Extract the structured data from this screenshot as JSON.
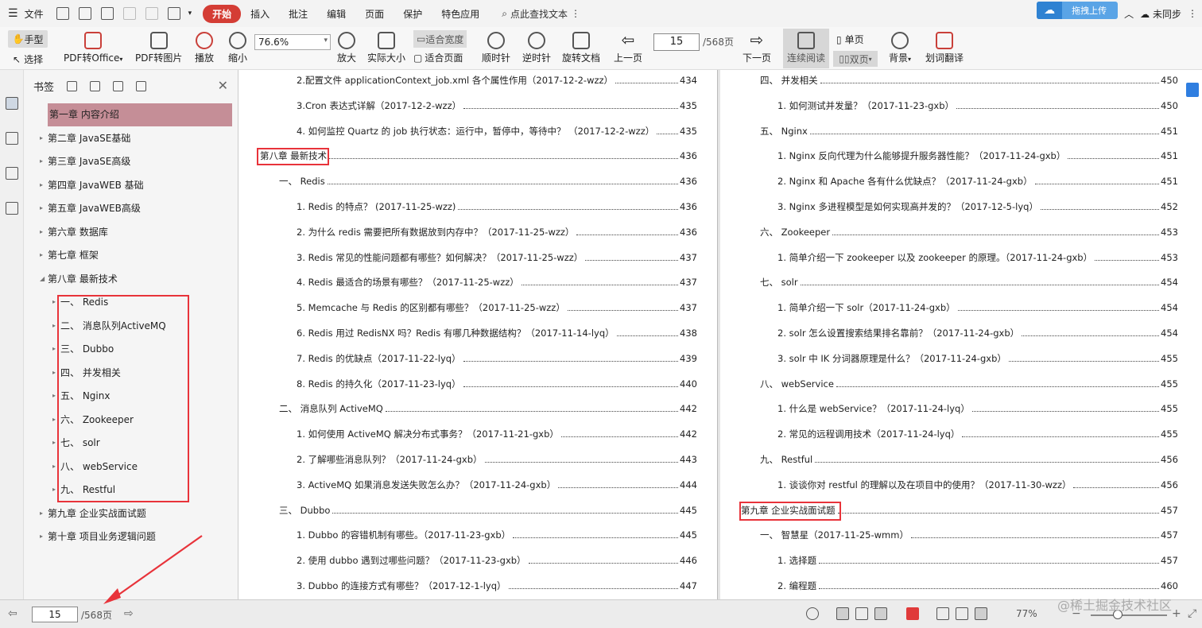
{
  "menu": {
    "file": "文件",
    "tabs": [
      "开始",
      "插入",
      "批注",
      "编辑",
      "页面",
      "保护",
      "特色应用"
    ],
    "search": "点此查找文本",
    "upload": "拖拽上传",
    "user": "未同步"
  },
  "toolbar": {
    "hand": "手型",
    "select": "选择",
    "pdf2office": "PDF转Office",
    "pdf2img": "PDF转图片",
    "play": "播放",
    "zoom_out": "缩小",
    "zoom_value": "76.6%",
    "zoom_in": "放大",
    "actual": "实际大小",
    "fit_width": "适合宽度",
    "fit_page": "适合页面",
    "cw": "顺时针",
    "ccw": "逆时针",
    "rotate": "旋转文档",
    "prev": "上一页",
    "page": "15",
    "total": "/568页",
    "next": "下一页",
    "continuous": "连续阅读",
    "single": "单页",
    "dual": "双页",
    "bg": "背景",
    "translate": "划词翻译"
  },
  "bookmarks": {
    "title": "书签",
    "items": [
      "第一章 内容介绍",
      "第二章 JavaSE基础",
      "第三章 JavaSE高级",
      "第四章 JavaWEB 基础",
      "第五章 JavaWEB高级",
      "第六章 数据库",
      "第七章 框架",
      "第八章 最新技术"
    ],
    "sub": [
      "一、 Redis",
      "二、 消息队列ActiveMQ",
      "三、 Dubbo",
      "四、 并发相关",
      "五、 Nginx",
      "六、 Zookeeper",
      "七、 solr",
      "八、 webService",
      "九、 Restful"
    ],
    "after": [
      "第九章 企业实战面试题",
      "第十章 项目业务逻辑问题"
    ]
  },
  "left_toc": [
    {
      "t": "2.配置文件 applicationContext_job.xml 各个属性作用（2017-12-2-wzz）",
      "p": "434",
      "lv": 2
    },
    {
      "t": "3.Cron 表达式详解（2017-12-2-wzz）",
      "p": "435",
      "lv": 2
    },
    {
      "t": "4. 如何监控 Quartz 的 job 执行状态：运行中，暂停中，等待中？ （2017-12-2-wzz）",
      "p": "435",
      "lv": 2
    },
    {
      "t": "第八章  最新技术",
      "p": "436",
      "lv": 0
    },
    {
      "t": "一、  Redis",
      "p": "436",
      "lv": 1
    },
    {
      "t": "1. Redis 的特点？ (2017-11-25-wzz)",
      "p": "436",
      "lv": 2
    },
    {
      "t": "2. 为什么 redis 需要把所有数据放到内存中？（2017-11-25-wzz）",
      "p": "436",
      "lv": 2
    },
    {
      "t": "3. Redis 常见的性能问题都有哪些？如何解决？（2017-11-25-wzz）",
      "p": "437",
      "lv": 2
    },
    {
      "t": "4. Redis 最适合的场景有哪些？（2017-11-25-wzz）",
      "p": "437",
      "lv": 2
    },
    {
      "t": "5. Memcache 与 Redis 的区别都有哪些？（2017-11-25-wzz）",
      "p": "437",
      "lv": 2
    },
    {
      "t": "6. Redis 用过 RedisNX 吗？Redis 有哪几种数据结构？（2017-11-14-lyq）",
      "p": "438",
      "lv": 2
    },
    {
      "t": "7. Redis 的优缺点（2017-11-22-lyq）",
      "p": "439",
      "lv": 2
    },
    {
      "t": "8. Redis 的持久化（2017-11-23-lyq）",
      "p": "440",
      "lv": 2
    },
    {
      "t": "二、  消息队列 ActiveMQ",
      "p": "442",
      "lv": 1
    },
    {
      "t": "1. 如何使用 ActiveMQ 解决分布式事务？（2017-11-21-gxb）",
      "p": "442",
      "lv": 2
    },
    {
      "t": "2. 了解哪些消息队列？（2017-11-24-gxb）",
      "p": "443",
      "lv": 2
    },
    {
      "t": "3. ActiveMQ 如果消息发送失败怎么办？（2017-11-24-gxb）",
      "p": "444",
      "lv": 2
    },
    {
      "t": "三、  Dubbo",
      "p": "445",
      "lv": 1
    },
    {
      "t": "1. Dubbo 的容错机制有哪些。（2017-11-23-gxb）",
      "p": "445",
      "lv": 2
    },
    {
      "t": "2. 使用 dubbo 遇到过哪些问题？（2017-11-23-gxb）",
      "p": "446",
      "lv": 2
    },
    {
      "t": "3. Dubbo 的连接方式有哪些？（2017-12-1-lyq）",
      "p": "447",
      "lv": 2
    }
  ],
  "right_toc": [
    {
      "t": "四、  并发相关",
      "p": "450",
      "lv": 1
    },
    {
      "t": "1. 如何测试并发量？（2017-11-23-gxb）",
      "p": "450",
      "lv": 2
    },
    {
      "t": "五、  Nginx",
      "p": "451",
      "lv": 1
    },
    {
      "t": "1. Nginx 反向代理为什么能够提升服务器性能？（2017-11-24-gxb）",
      "p": "451",
      "lv": 2
    },
    {
      "t": "2. Nginx 和 Apache 各有什么优缺点？（2017-11-24-gxb）",
      "p": "451",
      "lv": 2
    },
    {
      "t": "3. Nginx 多进程模型是如何实现高并发的？（2017-12-5-lyq）",
      "p": "452",
      "lv": 2
    },
    {
      "t": "六、  Zookeeper",
      "p": "453",
      "lv": 1
    },
    {
      "t": "1. 简单介绍一下 zookeeper 以及 zookeeper 的原理。（2017-11-24-gxb）",
      "p": "453",
      "lv": 2
    },
    {
      "t": "七、  solr",
      "p": "454",
      "lv": 1
    },
    {
      "t": "1. 简单介绍一下 solr（2017-11-24-gxb）",
      "p": "454",
      "lv": 2
    },
    {
      "t": "2. solr 怎么设置搜索结果排名靠前？（2017-11-24-gxb）",
      "p": "454",
      "lv": 2
    },
    {
      "t": "3. solr 中 IK 分词器原理是什么？（2017-11-24-gxb）",
      "p": "455",
      "lv": 2
    },
    {
      "t": "八、  webService",
      "p": "455",
      "lv": 1
    },
    {
      "t": "1. 什么是 webService？（2017-11-24-lyq）",
      "p": "455",
      "lv": 2
    },
    {
      "t": "2. 常见的远程调用技术（2017-11-24-lyq）",
      "p": "455",
      "lv": 2
    },
    {
      "t": "九、  Restful",
      "p": "456",
      "lv": 1
    },
    {
      "t": "1. 谈谈你对 restful 的理解以及在项目中的使用？（2017-11-30-wzz）",
      "p": "456",
      "lv": 2
    },
    {
      "t": "第九章  企业实战面试题",
      "p": "457",
      "lv": 0
    },
    {
      "t": "一、  智慧星（2017-11-25-wmm）",
      "p": "457",
      "lv": 1
    },
    {
      "t": "1. 选择题",
      "p": "457",
      "lv": 2
    },
    {
      "t": "2. 编程题",
      "p": "460",
      "lv": 2
    }
  ],
  "status": {
    "page": "15",
    "total": "/568页",
    "zoom": "77%"
  },
  "watermark": "@稀土掘金技术社区",
  "colors": {
    "accent": "#d43d35",
    "highlight": "#c58e97",
    "annotation": "#e8333a"
  }
}
